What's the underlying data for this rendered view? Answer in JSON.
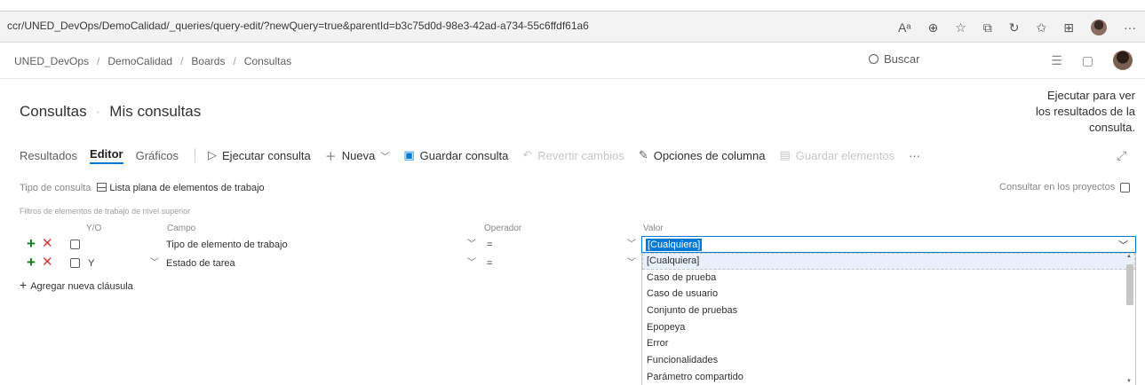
{
  "browser": {
    "url": "ccr/UNED_DevOps/DemoCalidad/_queries/query-edit/?newQuery=true&parentId=b3c75d0d-98e3-42ad-a734-55c6ffdf61a6",
    "icons": [
      "read-aloud-icon",
      "zoom-icon",
      "favorites-add-icon",
      "extensions-icon",
      "refresh-icon",
      "favorites-icon",
      "collections-icon",
      "profile-icon",
      "more-icon"
    ]
  },
  "header": {
    "breadcrumb": [
      "UNED_DevOps",
      "DemoCalidad",
      "Boards",
      "Consultas"
    ],
    "search_placeholder": "Buscar"
  },
  "page": {
    "title": "Consultas",
    "subtitle": "Mis consultas",
    "tooltip": "Ejecutar para ver los resultados de la consulta."
  },
  "toolbar": {
    "tabs": [
      "Resultados",
      "Editor",
      "Gráficos"
    ],
    "active_tab": "Editor",
    "run_query": "Ejecutar consulta",
    "new": "Nueva",
    "save_query": "Guardar consulta",
    "revert_changes": "Revertir cambios",
    "column_options": "Opciones de columna",
    "save_items": "Guardar elementos",
    "more": "···"
  },
  "query": {
    "type_label": "Tipo de consulta",
    "type_value": "Lista plana de elementos de trabajo",
    "cross_project_label": "Consultar en los proyectos",
    "filter_title": "Filtros de elementos de trabajo de nivel superior",
    "columns": {
      "andor": "Y/O",
      "field": "Campo",
      "operator": "Operador",
      "value": "Valor"
    },
    "clauses": [
      {
        "andor": "",
        "field": "Tipo de elemento de trabajo",
        "operator": "=",
        "value": "[Cualquiera]"
      },
      {
        "andor": "Y",
        "field": "Estado de tarea",
        "operator": "=",
        "value": ""
      }
    ],
    "add_clause": "Agregar nueva cláusula"
  },
  "dropdown": {
    "options": [
      "[Cualquiera]",
      "Caso de prueba",
      "Caso de usuario",
      "Conjunto de pruebas",
      "Epopeya",
      "Error",
      "Funcionalidades",
      "Parámetro compartido"
    ],
    "highlighted_index": 0
  },
  "colors": {
    "accent": "#0078d4",
    "add": "#107c10",
    "remove": "#d13438"
  }
}
